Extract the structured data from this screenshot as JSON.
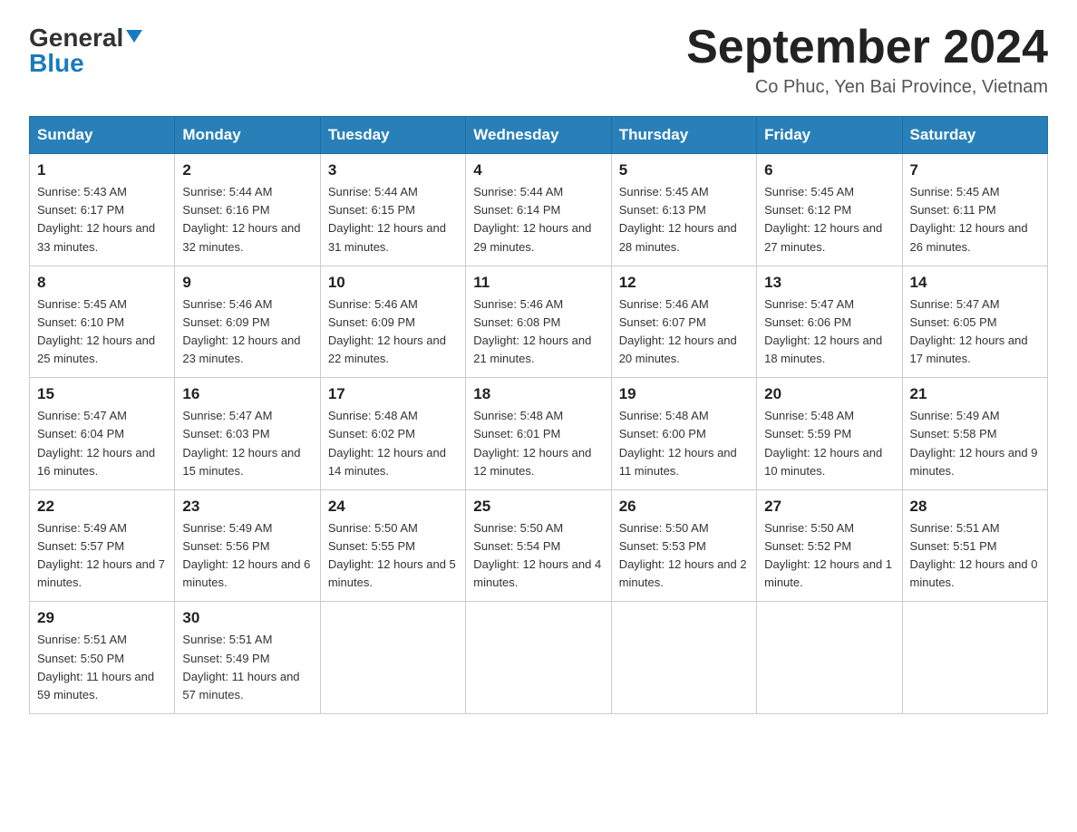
{
  "header": {
    "logo_general": "General",
    "logo_blue": "Blue",
    "month_title": "September 2024",
    "location": "Co Phuc, Yen Bai Province, Vietnam"
  },
  "days_of_week": [
    "Sunday",
    "Monday",
    "Tuesday",
    "Wednesday",
    "Thursday",
    "Friday",
    "Saturday"
  ],
  "weeks": [
    [
      {
        "day": "1",
        "sunrise": "5:43 AM",
        "sunset": "6:17 PM",
        "daylight": "12 hours and 33 minutes."
      },
      {
        "day": "2",
        "sunrise": "5:44 AM",
        "sunset": "6:16 PM",
        "daylight": "12 hours and 32 minutes."
      },
      {
        "day": "3",
        "sunrise": "5:44 AM",
        "sunset": "6:15 PM",
        "daylight": "12 hours and 31 minutes."
      },
      {
        "day": "4",
        "sunrise": "5:44 AM",
        "sunset": "6:14 PM",
        "daylight": "12 hours and 29 minutes."
      },
      {
        "day": "5",
        "sunrise": "5:45 AM",
        "sunset": "6:13 PM",
        "daylight": "12 hours and 28 minutes."
      },
      {
        "day": "6",
        "sunrise": "5:45 AM",
        "sunset": "6:12 PM",
        "daylight": "12 hours and 27 minutes."
      },
      {
        "day": "7",
        "sunrise": "5:45 AM",
        "sunset": "6:11 PM",
        "daylight": "12 hours and 26 minutes."
      }
    ],
    [
      {
        "day": "8",
        "sunrise": "5:45 AM",
        "sunset": "6:10 PM",
        "daylight": "12 hours and 25 minutes."
      },
      {
        "day": "9",
        "sunrise": "5:46 AM",
        "sunset": "6:09 PM",
        "daylight": "12 hours and 23 minutes."
      },
      {
        "day": "10",
        "sunrise": "5:46 AM",
        "sunset": "6:09 PM",
        "daylight": "12 hours and 22 minutes."
      },
      {
        "day": "11",
        "sunrise": "5:46 AM",
        "sunset": "6:08 PM",
        "daylight": "12 hours and 21 minutes."
      },
      {
        "day": "12",
        "sunrise": "5:46 AM",
        "sunset": "6:07 PM",
        "daylight": "12 hours and 20 minutes."
      },
      {
        "day": "13",
        "sunrise": "5:47 AM",
        "sunset": "6:06 PM",
        "daylight": "12 hours and 18 minutes."
      },
      {
        "day": "14",
        "sunrise": "5:47 AM",
        "sunset": "6:05 PM",
        "daylight": "12 hours and 17 minutes."
      }
    ],
    [
      {
        "day": "15",
        "sunrise": "5:47 AM",
        "sunset": "6:04 PM",
        "daylight": "12 hours and 16 minutes."
      },
      {
        "day": "16",
        "sunrise": "5:47 AM",
        "sunset": "6:03 PM",
        "daylight": "12 hours and 15 minutes."
      },
      {
        "day": "17",
        "sunrise": "5:48 AM",
        "sunset": "6:02 PM",
        "daylight": "12 hours and 14 minutes."
      },
      {
        "day": "18",
        "sunrise": "5:48 AM",
        "sunset": "6:01 PM",
        "daylight": "12 hours and 12 minutes."
      },
      {
        "day": "19",
        "sunrise": "5:48 AM",
        "sunset": "6:00 PM",
        "daylight": "12 hours and 11 minutes."
      },
      {
        "day": "20",
        "sunrise": "5:48 AM",
        "sunset": "5:59 PM",
        "daylight": "12 hours and 10 minutes."
      },
      {
        "day": "21",
        "sunrise": "5:49 AM",
        "sunset": "5:58 PM",
        "daylight": "12 hours and 9 minutes."
      }
    ],
    [
      {
        "day": "22",
        "sunrise": "5:49 AM",
        "sunset": "5:57 PM",
        "daylight": "12 hours and 7 minutes."
      },
      {
        "day": "23",
        "sunrise": "5:49 AM",
        "sunset": "5:56 PM",
        "daylight": "12 hours and 6 minutes."
      },
      {
        "day": "24",
        "sunrise": "5:50 AM",
        "sunset": "5:55 PM",
        "daylight": "12 hours and 5 minutes."
      },
      {
        "day": "25",
        "sunrise": "5:50 AM",
        "sunset": "5:54 PM",
        "daylight": "12 hours and 4 minutes."
      },
      {
        "day": "26",
        "sunrise": "5:50 AM",
        "sunset": "5:53 PM",
        "daylight": "12 hours and 2 minutes."
      },
      {
        "day": "27",
        "sunrise": "5:50 AM",
        "sunset": "5:52 PM",
        "daylight": "12 hours and 1 minute."
      },
      {
        "day": "28",
        "sunrise": "5:51 AM",
        "sunset": "5:51 PM",
        "daylight": "12 hours and 0 minutes."
      }
    ],
    [
      {
        "day": "29",
        "sunrise": "5:51 AM",
        "sunset": "5:50 PM",
        "daylight": "11 hours and 59 minutes."
      },
      {
        "day": "30",
        "sunrise": "5:51 AM",
        "sunset": "5:49 PM",
        "daylight": "11 hours and 57 minutes."
      },
      null,
      null,
      null,
      null,
      null
    ]
  ],
  "labels": {
    "sunrise": "Sunrise:",
    "sunset": "Sunset:",
    "daylight": "Daylight:"
  }
}
